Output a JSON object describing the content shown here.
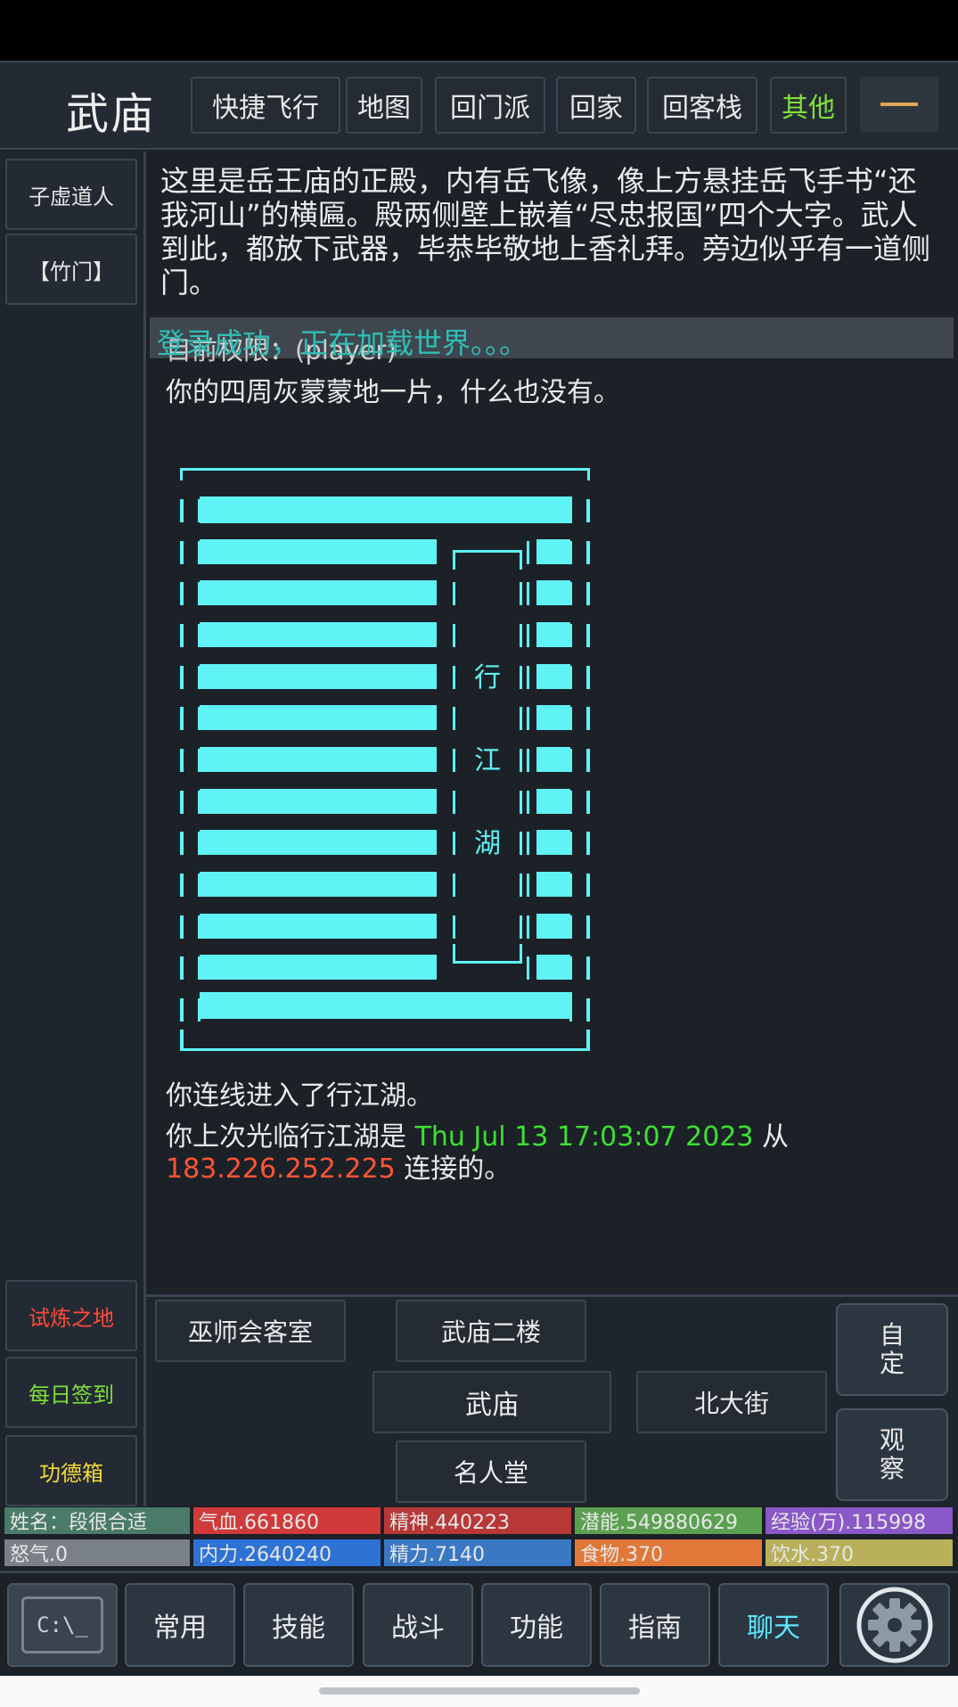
{
  "header": {
    "title": "武庙",
    "nav": [
      "快捷飞行",
      "地图",
      "回门派",
      "回家",
      "回客栈",
      "其他"
    ],
    "colors": {
      "nav_default": "#e8e8e8",
      "nav_highlight": "#7fe03a",
      "menu_line": "#e2a552"
    }
  },
  "left": {
    "npc": "子虚道人",
    "item": "【竹门】",
    "actions": [
      {
        "label": "试炼之地",
        "color": "#ff4a3a"
      },
      {
        "label": "每日签到",
        "color": "#7fe03a"
      },
      {
        "label": "功德箱",
        "color": "#f5d83a"
      }
    ]
  },
  "room": {
    "description": "这里是岳王庙的正殿，内有岳飞像，像上方悬挂岳飞手书“还我河山”的横匾。殿两侧壁上嵌着“尽忠报国”四个大字。武人到此，都放下武器，毕恭毕敬地上香礼拜。旁边似乎有一道侧门。",
    "permission": "目前权限：(player)",
    "login_notice": "登录成功，正在加载世界。。。",
    "surroundings": "你的四周灰蒙蒙地一片，什么也没有。",
    "logo_text": [
      "行",
      "江",
      "湖"
    ],
    "logo_color": "#5ff3f6"
  },
  "messages": {
    "connected": "你连线进入了行江湖。",
    "last_visit_prefix": "你上次光临行江湖是",
    "last_visit_time": "Thu Jul 13 17:03:07 2023",
    "last_visit_from": "从",
    "ip": "183.226.252.225",
    "suffix": "连接的。"
  },
  "exits": {
    "northwest": "巫师会客室",
    "north": "武庙二楼",
    "center": "武庙",
    "east": "北大街",
    "south": "名人堂"
  },
  "side_buttons": {
    "custom": "自定",
    "observe": "观察"
  },
  "stats": {
    "row1": [
      {
        "label": "姓名：段很合适",
        "color": "#4a7a6a"
      },
      {
        "label": "气血.661860",
        "color": "#d03a3a"
      },
      {
        "label": "精神.440223",
        "color": "#b83838"
      },
      {
        "label": "潜能.549880629",
        "color": "#5aa050"
      },
      {
        "label": "经验(万).115998",
        "color": "#8a58c8"
      }
    ],
    "row2": [
      {
        "label": "怒气.0",
        "color": "#7a8088"
      },
      {
        "label": "内力.2640240",
        "color": "#2e72d6"
      },
      {
        "label": "精力.7140",
        "color": "#3a78c4"
      },
      {
        "label": "食物.370",
        "color": "#e0783a"
      },
      {
        "label": "饮水.370",
        "color": "#b8b05a"
      }
    ]
  },
  "bottom_nav": {
    "console_label": "C:\\_",
    "tabs": [
      {
        "label": "常用",
        "color": "#eaeaea"
      },
      {
        "label": "技能",
        "color": "#eaeaea"
      },
      {
        "label": "战斗",
        "color": "#eaeaea"
      },
      {
        "label": "功能",
        "color": "#eaeaea"
      },
      {
        "label": "指南",
        "color": "#eaeaea"
      },
      {
        "label": "聊天",
        "color": "#5fe6ff"
      }
    ],
    "settings_icon": "gear-icon"
  }
}
